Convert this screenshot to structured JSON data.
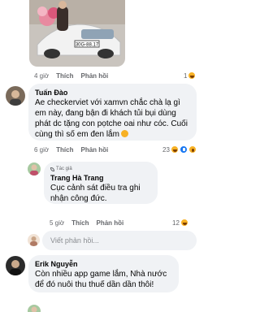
{
  "post_image": {
    "plate_text": "30G-88.17"
  },
  "comment_top": {
    "time": "4 giờ",
    "like_label": "Thích",
    "reply_label": "Phản hồi",
    "reaction_count": "1"
  },
  "comment_tuan": {
    "author": "Tuấn Đào",
    "text": "Ae checkerviet với xamvn chắc chà lạ gì em này, đang bận đi khách tủi bụi dùng phát dc tặng con pọtche oai như cóc. Cuối cùng thì số em đen lắm",
    "time": "6 giờ",
    "like_label": "Thích",
    "reply_label": "Phản hồi",
    "reaction_count": "23"
  },
  "reply_trang": {
    "badge": "Tác giả",
    "author": "Trang Hà Trang",
    "text": "Cục cảnh sát điều tra ghi nhận công đức.",
    "time": "5 giờ",
    "like_label": "Thích",
    "reply_label": "Phản hồi",
    "reaction_count": "12"
  },
  "reply_box": {
    "placeholder": "Viết phản hồi..."
  },
  "comment_erik": {
    "author": "Erik Nguyễn",
    "text": "Còn nhiều app game lắm, Nhà nước để đó nuôi thu thuế dần dần thôi!"
  },
  "colors": {
    "bubble": "#f0f2f5",
    "meta": "#65676b",
    "like": "#1877f2",
    "haha": "#f7b125"
  }
}
